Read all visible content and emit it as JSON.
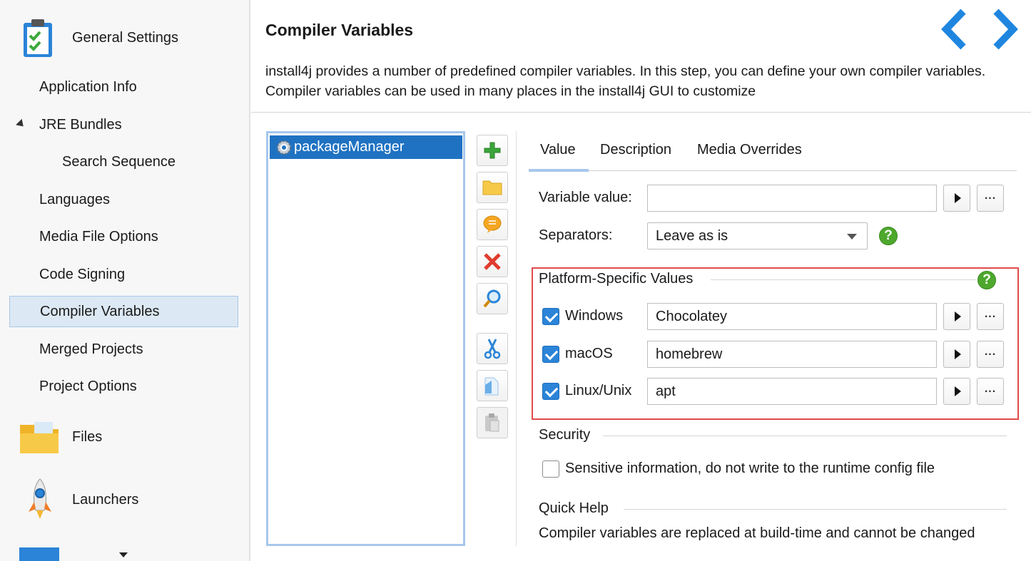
{
  "sidebar": {
    "general_settings": "General Settings",
    "items": [
      {
        "label": "Application Info"
      },
      {
        "label": "JRE Bundles"
      },
      {
        "label": "Search Sequence"
      },
      {
        "label": "Languages"
      },
      {
        "label": "Media File Options"
      },
      {
        "label": "Code Signing"
      },
      {
        "label": "Compiler Variables"
      },
      {
        "label": "Merged Projects"
      },
      {
        "label": "Project Options"
      }
    ],
    "files": "Files",
    "launchers": "Launchers"
  },
  "header": {
    "title": "Compiler Variables",
    "description": "install4j provides a number of predefined compiler variables. In this step, you can define your own compiler variables. Compiler variables can be used in many places in the install4j GUI to customize"
  },
  "variables": {
    "items": [
      {
        "name": "packageManager"
      }
    ]
  },
  "tabs": [
    {
      "label": "Value"
    },
    {
      "label": "Description"
    },
    {
      "label": "Media Overrides"
    }
  ],
  "form": {
    "variable_value_label": "Variable value:",
    "variable_value": "",
    "separators_label": "Separators:",
    "separators_value": "Leave as is",
    "help_char": "?",
    "platform_group": "Platform-Specific Values",
    "platforms": [
      {
        "label": "Windows",
        "value": "Chocolatey",
        "checked": true
      },
      {
        "label": "macOS",
        "value": "homebrew",
        "checked": true
      },
      {
        "label": "Linux/Unix",
        "value": "apt",
        "checked": true
      }
    ],
    "security_group": "Security",
    "sensitive_label": "Sensitive information, do not write to the runtime config file",
    "sensitive_checked": false,
    "quick_help_group": "Quick Help",
    "quick_help_text": "Compiler variables are replaced at build-time and cannot be changed"
  },
  "colors": {
    "accent": "#1f72c2",
    "selection_border": "#a7c7ec",
    "highlight_box": "#e04b4b",
    "help_green": "#4da82d"
  }
}
